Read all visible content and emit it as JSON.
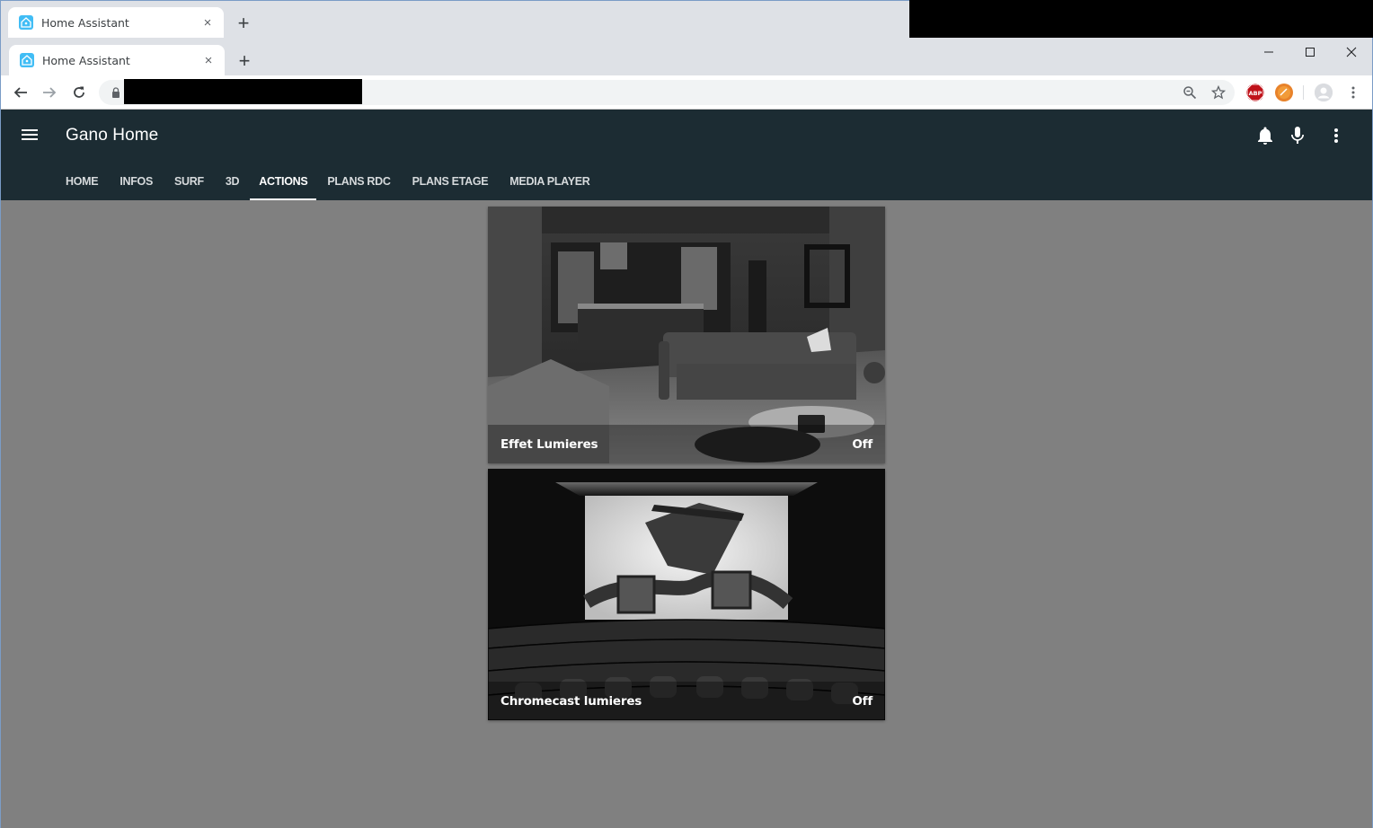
{
  "browser": {
    "ghost_tab": {
      "title": "Home Assistant",
      "close": "×"
    },
    "tab": {
      "title": "Home Assistant",
      "close": "×"
    },
    "new_tab": "+",
    "window_controls": {
      "minimize": "—",
      "maximize": "☐",
      "close": "✕"
    }
  },
  "app": {
    "title": "Gano Home",
    "tabs": [
      {
        "label": "HOME"
      },
      {
        "label": "INFOS"
      },
      {
        "label": "SURF"
      },
      {
        "label": "3D"
      },
      {
        "label": "ACTIONS",
        "active": true
      },
      {
        "label": "PLANS RDC"
      },
      {
        "label": "PLANS ETAGE"
      },
      {
        "label": "MEDIA PLAYER"
      }
    ],
    "header_icons": [
      "menu-icon",
      "bell-icon",
      "microphone-icon",
      "more-vert-icon"
    ]
  },
  "cards": [
    {
      "name": "Effet Lumieres",
      "state": "Off",
      "image": "living-room-scene"
    },
    {
      "name": "Chromecast lumieres",
      "state": "Off",
      "image": "cinema-scene"
    }
  ],
  "colors": {
    "header_bg": "#1c2c33",
    "content_bg": "#808080",
    "tabstrip_bg": "#dee1e6",
    "favicon": "#41bdf5"
  }
}
